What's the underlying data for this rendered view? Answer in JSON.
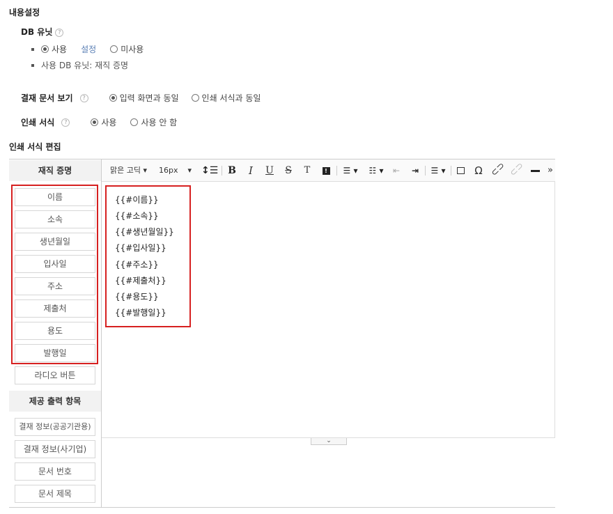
{
  "section_title": "내용설정",
  "db_unit": {
    "label": "DB 유닛",
    "use_label": "사용",
    "settings_link": "설정",
    "unused_label": "미사용",
    "info": "사용 DB 유닛: 재직 증명"
  },
  "approval_view": {
    "label": "결재 문서 보기",
    "option1": "입력 화면과 동일",
    "option2": "인쇄 서식과 동일"
  },
  "print_format": {
    "label": "인쇄 서식",
    "option1": "사용",
    "option2": "사용 안 함"
  },
  "edit_title": "인쇄 서식 편집",
  "sidebar": {
    "group1_title": "재직 증명",
    "fields": [
      "이름",
      "소속",
      "생년월일",
      "입사일",
      "주소",
      "제출처",
      "용도",
      "발행일"
    ],
    "radio_button": "라디오 버튼",
    "group2_title": "제공 출력 항목",
    "outputs": [
      "결재 정보(공공기관용)",
      "결재 정보(사기업)",
      "문서 번호",
      "문서 제목"
    ]
  },
  "toolbar": {
    "font": "맑은 고딕",
    "size": "16px",
    "bold": "B",
    "italic": "I",
    "underline": "U",
    "strike": "S",
    "text": "T",
    "omega": "Ω",
    "more": "»"
  },
  "editor_lines": [
    "{{#이름}}",
    "{{#소속}}",
    "{{#생년월일}}",
    "{{#입사일}}",
    "{{#주소}}",
    "{{#제출처}}",
    "{{#용도}}",
    "{{#발행일}}"
  ],
  "colors": {
    "highlight": "#d62020",
    "link": "#5a7fb5"
  }
}
